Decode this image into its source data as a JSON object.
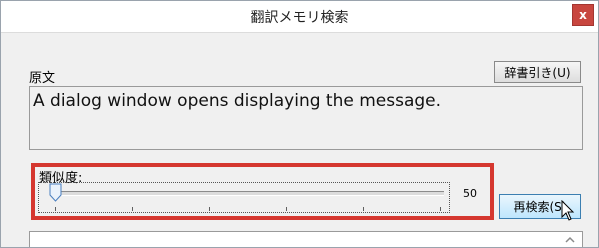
{
  "window": {
    "title": "翻訳メモリ検索",
    "close_label": "x"
  },
  "source": {
    "label": "原文",
    "dict_button": "辞書引き(U)",
    "text": "A dialog window opens displaying the message."
  },
  "similarity": {
    "label": "類似度:",
    "value": "50",
    "slider_position": 0
  },
  "research_button": "再検索(S)",
  "colors": {
    "highlight": "#d5372f",
    "close": "#c8463f",
    "button_hover": "#bee6fd"
  },
  "icons": [
    "close-icon",
    "slider-thumb-icon",
    "mouse-cursor-icon",
    "scroll-up-arrow-icon"
  ]
}
